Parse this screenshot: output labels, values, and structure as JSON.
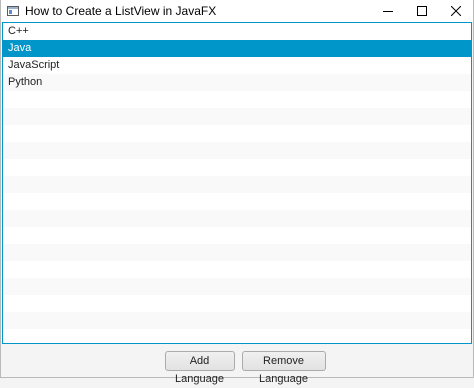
{
  "window": {
    "title": "How to Create a ListView in JavaFX",
    "controls": [
      "minimize-icon",
      "maximize-icon",
      "close-icon"
    ]
  },
  "list": {
    "items": [
      "C++",
      "Java",
      "JavaScript",
      "Python"
    ],
    "selected_index": 1,
    "empty_rows": 14
  },
  "buttons": {
    "add_label": "Add Language",
    "remove_label": "Remove Language"
  },
  "colors": {
    "selection": "#0096c9",
    "focus_border": "#0096c9",
    "row_alt": "#f9f9f9"
  }
}
